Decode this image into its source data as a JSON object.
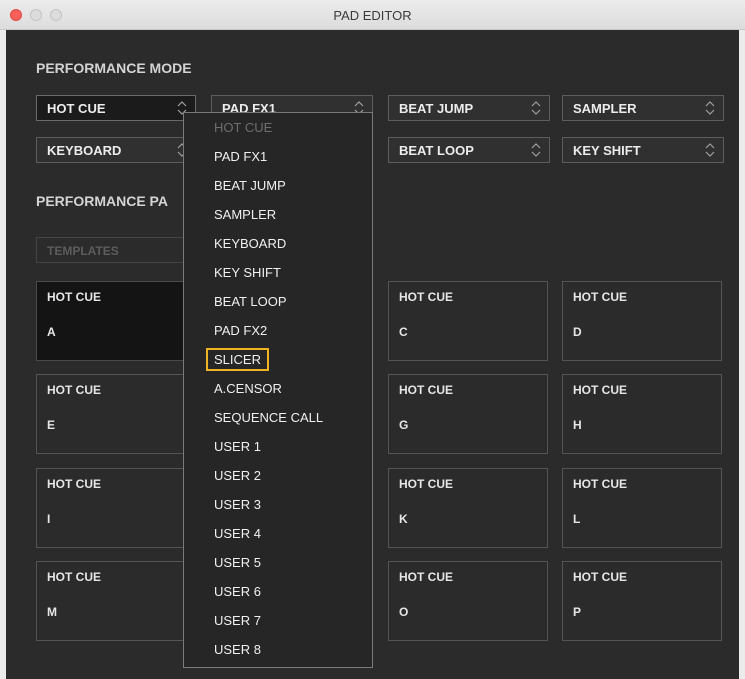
{
  "window": {
    "title": "PAD EDITOR"
  },
  "performance_mode": {
    "heading": "PERFORMANCE MODE",
    "selects": [
      {
        "label": "HOT CUE"
      },
      {
        "label": "PAD FX1"
      },
      {
        "label": "BEAT JUMP"
      },
      {
        "label": "SAMPLER"
      },
      {
        "label": "KEYBOARD"
      },
      {
        "label": "BEAT LOOP"
      },
      {
        "label": "KEY SHIFT"
      }
    ]
  },
  "performance_pad": {
    "heading_visible": "PERFORMANCE PA",
    "templates_label": "TEMPLATES",
    "pads": [
      {
        "mode": "HOT CUE",
        "letter": "A"
      },
      {
        "mode": "HOT CUE",
        "letter": "C"
      },
      {
        "mode": "HOT CUE",
        "letter": "D"
      },
      {
        "mode": "HOT CUE",
        "letter": "E"
      },
      {
        "mode": "HOT CUE",
        "letter": "G"
      },
      {
        "mode": "HOT CUE",
        "letter": "H"
      },
      {
        "mode": "HOT CUE",
        "letter": "I"
      },
      {
        "mode": "HOT CUE",
        "letter": "K"
      },
      {
        "mode": "HOT CUE",
        "letter": "L"
      },
      {
        "mode": "HOT CUE",
        "letter": "M"
      },
      {
        "mode": "HOT CUE",
        "letter": "O"
      },
      {
        "mode": "HOT CUE",
        "letter": "P"
      }
    ]
  },
  "dropdown": {
    "items": [
      "HOT CUE",
      "PAD FX1",
      "BEAT JUMP",
      "SAMPLER",
      "KEYBOARD",
      "KEY SHIFT",
      "BEAT LOOP",
      "PAD FX2",
      "SLICER",
      "A.CENSOR",
      "SEQUENCE CALL",
      "USER 1",
      "USER 2",
      "USER 3",
      "USER 4",
      "USER 5",
      "USER 6",
      "USER 7",
      "USER 8"
    ],
    "disabled_item": "HOT CUE",
    "highlighted_item": "SLICER"
  },
  "colors": {
    "highlight": "#f0b324",
    "panel": "#2b2b2b"
  }
}
